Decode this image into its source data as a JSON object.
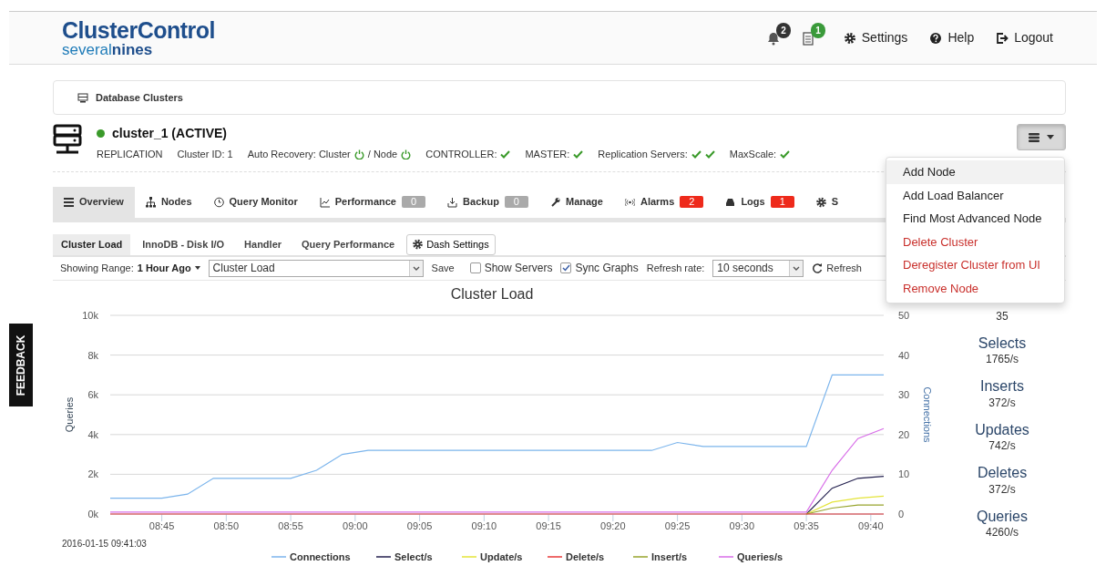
{
  "header": {
    "logo_title": "ClusterControl",
    "logo_sub_plain": "several",
    "logo_sub_bold": "nines",
    "notifications": [
      {
        "badge": "2",
        "kind": "alarm"
      },
      {
        "badge": "1",
        "kind": "job"
      }
    ],
    "links": [
      "Settings",
      "Help",
      "Logout"
    ]
  },
  "breadcrumb": "Database Clusters",
  "cluster": {
    "name": "cluster_1 (ACTIVE)",
    "online": true,
    "info": [
      {
        "kind": "text",
        "text": "REPLICATION"
      },
      {
        "kind": "text",
        "text": "Cluster ID: 1"
      },
      {
        "kind": "recovery",
        "cluster_label": "Auto Recovery: Cluster",
        "cluster_on": true,
        "node_label": "/ Node",
        "node_on": true
      },
      {
        "kind": "status",
        "label": "CONTROLLER:",
        "ok": [
          true
        ]
      },
      {
        "kind": "status",
        "label": "MASTER:",
        "ok": [
          true
        ]
      },
      {
        "kind": "status",
        "label": "Replication Servers:",
        "ok": [
          true,
          true
        ]
      },
      {
        "kind": "status",
        "label": "MaxScale:",
        "ok": [
          true
        ]
      }
    ],
    "menu": {
      "expanded": true,
      "items": [
        {
          "label": "Add Node",
          "danger": false,
          "selected": true
        },
        {
          "label": "Add Load Balancer",
          "danger": false,
          "selected": false
        },
        {
          "label": "Find Most Advanced Node",
          "danger": false,
          "selected": false
        },
        {
          "label": "Delete Cluster",
          "danger": true,
          "selected": false
        },
        {
          "label": "Deregister Cluster from UI",
          "danger": true,
          "selected": false
        },
        {
          "label": "Remove Node",
          "danger": true,
          "selected": false
        }
      ]
    }
  },
  "tabs": [
    {
      "label": "Overview",
      "selected": true
    },
    {
      "label": "Nodes",
      "selected": false
    },
    {
      "label": "Query Monitor",
      "selected": false
    },
    {
      "label": "Performance",
      "badge": "0",
      "alert": false,
      "selected": false
    },
    {
      "label": "Backup",
      "badge": "0",
      "alert": false,
      "selected": false
    },
    {
      "label": "Manage",
      "selected": false
    },
    {
      "label": "Alarms",
      "badge": "2",
      "alert": true,
      "selected": false
    },
    {
      "label": "Logs",
      "badge": "1",
      "alert": true,
      "selected": false
    },
    {
      "label": "S",
      "selected": false
    }
  ],
  "subtabs": [
    {
      "label": "Cluster Load",
      "selected": true
    },
    {
      "label": "InnoDB - Disk I/O",
      "selected": false
    },
    {
      "label": "Handler",
      "selected": false
    },
    {
      "label": "Query Performance",
      "selected": false
    }
  ],
  "dash_settings": "Dash Settings",
  "toolbar": {
    "range_label": "Showing Range:",
    "range_value": "1 Hour Ago",
    "dashboard": "Cluster Load",
    "save": "Save",
    "checkboxes": [
      {
        "label": "Show Servers",
        "checked": false
      },
      {
        "label": "Sync Graphs",
        "checked": true
      }
    ],
    "refresh_label": "Refresh rate:",
    "refresh_rate": "10 seconds",
    "refresh": "Refresh"
  },
  "feedback": "FEEDBACK",
  "chart": {
    "timestamp": "2016-01-15 09:41:03",
    "chart_data": {
      "type": "line",
      "title": "Cluster Load",
      "ylabel": "Queries",
      "y2label": "Connections",
      "x": [
        521,
        523,
        525,
        527,
        529,
        531,
        533,
        535,
        537,
        539,
        541,
        543,
        545,
        547,
        549,
        551,
        553,
        555,
        557,
        559,
        561,
        563,
        565,
        567,
        569,
        571,
        573,
        575,
        577,
        579,
        581
      ],
      "xlim": [
        521,
        581
      ],
      "ylim": [
        0,
        10000
      ],
      "grid": true,
      "legend": "bottom",
      "y2lim": [
        0,
        50
      ],
      "yticks": [
        {
          "value": 0,
          "label": "0k"
        },
        {
          "value": 2000,
          "label": "2k"
        },
        {
          "value": 4000,
          "label": "4k"
        },
        {
          "value": 6000,
          "label": "6k"
        },
        {
          "value": 8000,
          "label": "8k"
        },
        {
          "value": 10000,
          "label": "10k"
        }
      ],
      "y2ticks": [
        0,
        10,
        20,
        30,
        40,
        50
      ],
      "xticks": [
        {
          "value": 525,
          "label": "08:45"
        },
        {
          "value": 530,
          "label": "08:50"
        },
        {
          "value": 535,
          "label": "08:55"
        },
        {
          "value": 540,
          "label": "09:00"
        },
        {
          "value": 545,
          "label": "09:05"
        },
        {
          "value": 550,
          "label": "09:10"
        },
        {
          "value": 555,
          "label": "09:15"
        },
        {
          "value": 560,
          "label": "09:20"
        },
        {
          "value": 565,
          "label": "09:25"
        },
        {
          "value": 570,
          "label": "09:30"
        },
        {
          "value": 575,
          "label": "09:35"
        },
        {
          "value": 580,
          "label": "09:40"
        }
      ],
      "series": [
        {
          "name": "Connections",
          "color": "#7cb5ec",
          "axis": "y2",
          "values": [
            4,
            4,
            4,
            5,
            9,
            9,
            9,
            9,
            11,
            15,
            16,
            16,
            16,
            16,
            16,
            16,
            16,
            16,
            16,
            16,
            16,
            16,
            18,
            17,
            17,
            17,
            17,
            17,
            35,
            35,
            35
          ]
        },
        {
          "name": "Select/s",
          "color": "#24214f",
          "values": [
            null,
            null,
            null,
            null,
            null,
            null,
            null,
            null,
            null,
            null,
            null,
            null,
            null,
            null,
            null,
            null,
            null,
            null,
            null,
            null,
            null,
            null,
            null,
            null,
            null,
            null,
            null,
            0,
            1300,
            1800,
            1900
          ]
        },
        {
          "name": "Update/s",
          "color": "#e4e43a",
          "values": [
            null,
            null,
            null,
            null,
            null,
            null,
            null,
            null,
            null,
            null,
            null,
            null,
            null,
            null,
            null,
            null,
            null,
            null,
            null,
            null,
            null,
            null,
            null,
            null,
            null,
            null,
            null,
            0,
            600,
            800,
            900
          ]
        },
        {
          "name": "Delete/s",
          "color": "#e83a3a",
          "values": [
            0,
            0,
            0,
            0,
            0,
            0,
            0,
            0,
            0,
            0,
            0,
            0,
            0,
            0,
            0,
            0,
            0,
            0,
            0,
            0,
            0,
            0,
            0,
            0,
            0,
            0,
            0,
            0,
            0,
            0,
            0
          ]
        },
        {
          "name": "Insert/s",
          "color": "#97a42c",
          "values": [
            null,
            null,
            null,
            null,
            null,
            null,
            null,
            null,
            null,
            null,
            null,
            null,
            null,
            null,
            null,
            null,
            null,
            null,
            null,
            null,
            null,
            null,
            null,
            null,
            null,
            null,
            null,
            0,
            300,
            450,
            450
          ]
        },
        {
          "name": "Queries/s",
          "color": "#d86ee8",
          "values": [
            100,
            100,
            100,
            100,
            100,
            100,
            100,
            100,
            100,
            100,
            100,
            100,
            100,
            100,
            100,
            100,
            100,
            100,
            100,
            100,
            100,
            100,
            100,
            100,
            100,
            100,
            100,
            100,
            2200,
            3800,
            4300
          ]
        }
      ]
    }
  },
  "stats": [
    {
      "value": "35"
    },
    {
      "label": "Selects",
      "value": "1765/s"
    },
    {
      "label": "Inserts",
      "value": "372/s"
    },
    {
      "label": "Updates",
      "value": "742/s"
    },
    {
      "label": "Deletes",
      "value": "372/s"
    },
    {
      "label": "Queries",
      "value": "4260/s"
    }
  ]
}
